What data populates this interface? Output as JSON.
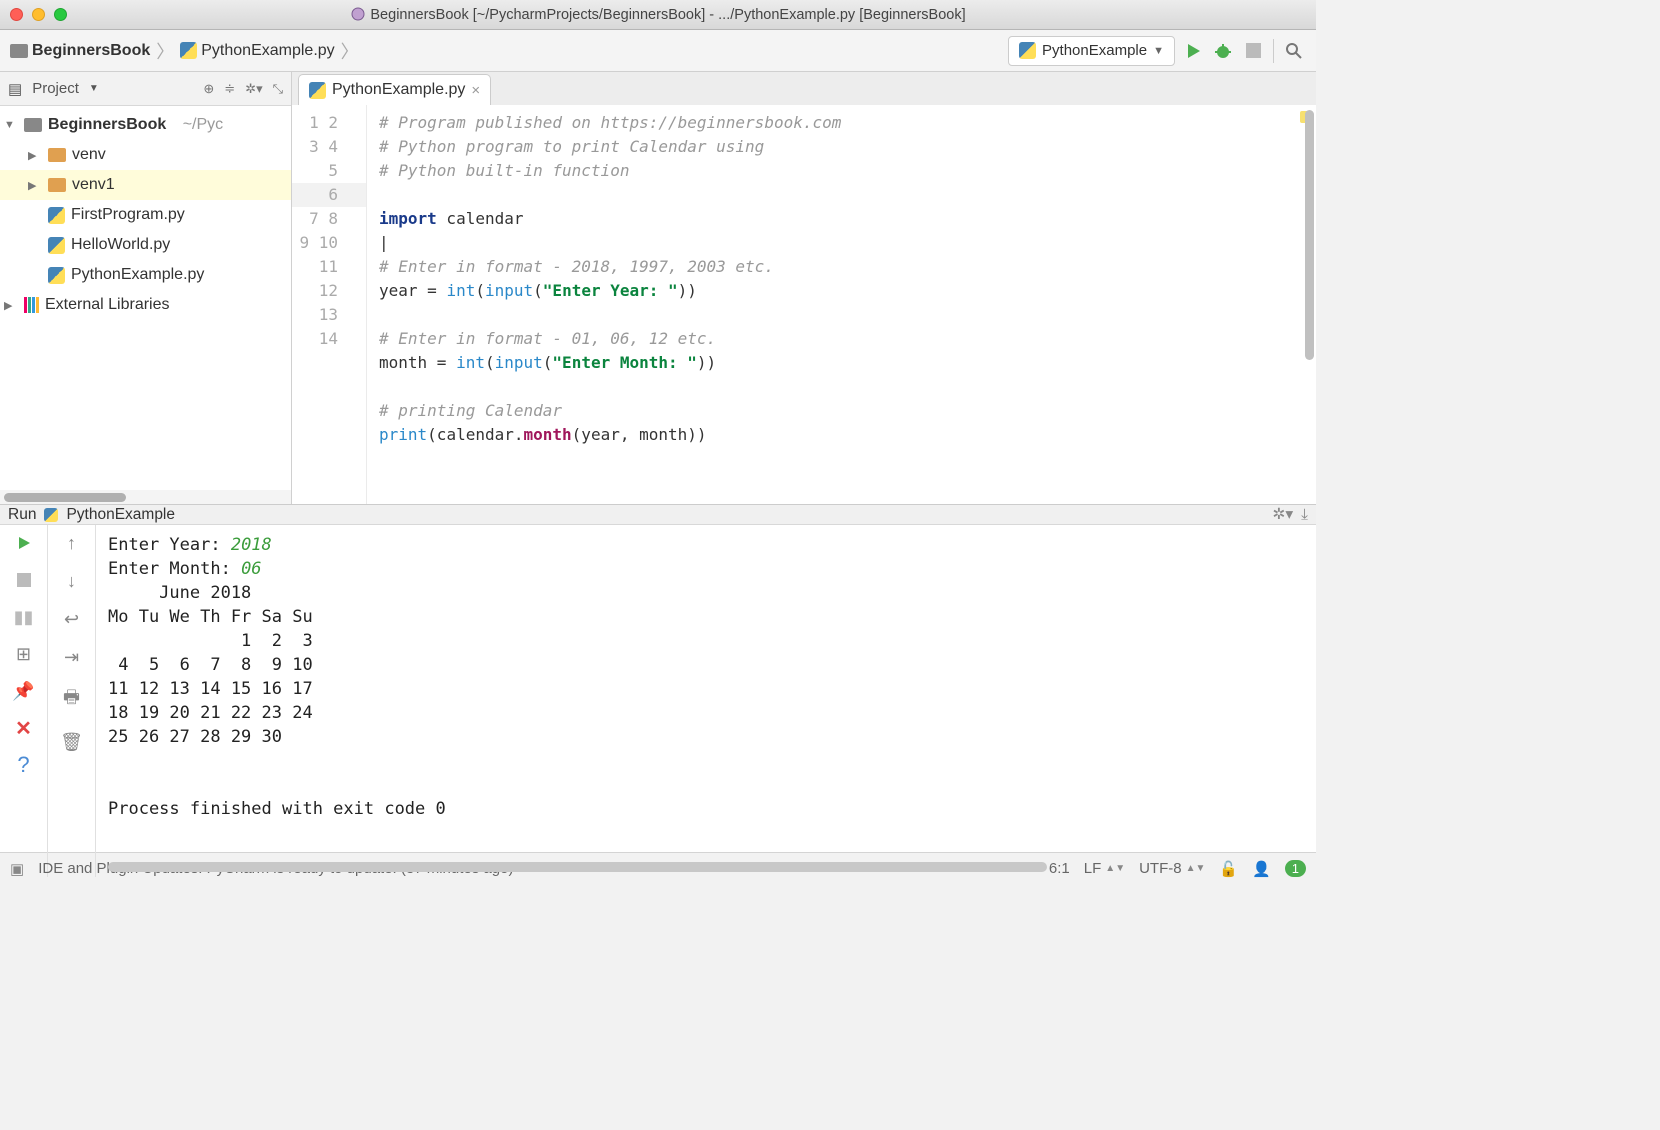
{
  "window": {
    "title": "BeginnersBook [~/PycharmProjects/BeginnersBook] - .../PythonExample.py [BeginnersBook]"
  },
  "breadcrumb": {
    "project": "BeginnersBook",
    "file": "PythonExample.py"
  },
  "runconfig": {
    "name": "PythonExample"
  },
  "project_panel": {
    "header": "Project",
    "root": "BeginnersBook",
    "root_path": "~/Pyc",
    "items": [
      {
        "name": "venv",
        "kind": "folder"
      },
      {
        "name": "venv1",
        "kind": "folder"
      },
      {
        "name": "FirstProgram.py",
        "kind": "py"
      },
      {
        "name": "HelloWorld.py",
        "kind": "py"
      },
      {
        "name": "PythonExample.py",
        "kind": "py"
      }
    ],
    "external": "External Libraries"
  },
  "editor": {
    "tab": "PythonExample.py",
    "lines": [
      "1",
      "2",
      "3",
      "4",
      "5",
      "6",
      "7",
      "8",
      "9",
      "10",
      "11",
      "12",
      "13",
      "14"
    ],
    "code": {
      "l1": "# Program published on https://beginnersbook.com",
      "l2": "# Python program to print Calendar using",
      "l3": "# Python built-in function",
      "l5kw": "import",
      "l5mod": " calendar",
      "l7": "# Enter in format - 2018, 1997, 2003 etc.",
      "l8a": "year = ",
      "l8b": "int",
      "l8c": "(",
      "l8d": "input",
      "l8e": "(",
      "l8f": "\"Enter Year: \"",
      "l8g": "))",
      "l10": "# Enter in format - 01, 06, 12 etc.",
      "l11a": "month = ",
      "l11b": "int",
      "l11c": "(",
      "l11d": "input",
      "l11e": "(",
      "l11f": "\"Enter Month: \"",
      "l11g": "))",
      "l13": "# printing Calendar",
      "l14a": "print",
      "l14b": "(calendar.",
      "l14c": "month",
      "l14d": "(year, month))"
    }
  },
  "run": {
    "label": "Run",
    "config": "PythonExample",
    "output": {
      "p1": "Enter Year: ",
      "i1": "2018",
      "p2": "Enter Month: ",
      "i2": "06",
      "cal": "     June 2018\nMo Tu We Th Fr Sa Su\n             1  2  3\n 4  5  6  7  8  9 10\n11 12 13 14 15 16 17\n18 19 20 21 22 23 24\n25 26 27 28 29 30",
      "exit": "Process finished with exit code 0"
    }
  },
  "status": {
    "message": "IDE and Plugin Updates: PyCharm is ready to update. (37 minutes ago)",
    "pos": "6:1",
    "sep": "LF",
    "enc": "UTF-8",
    "badge": "1"
  }
}
